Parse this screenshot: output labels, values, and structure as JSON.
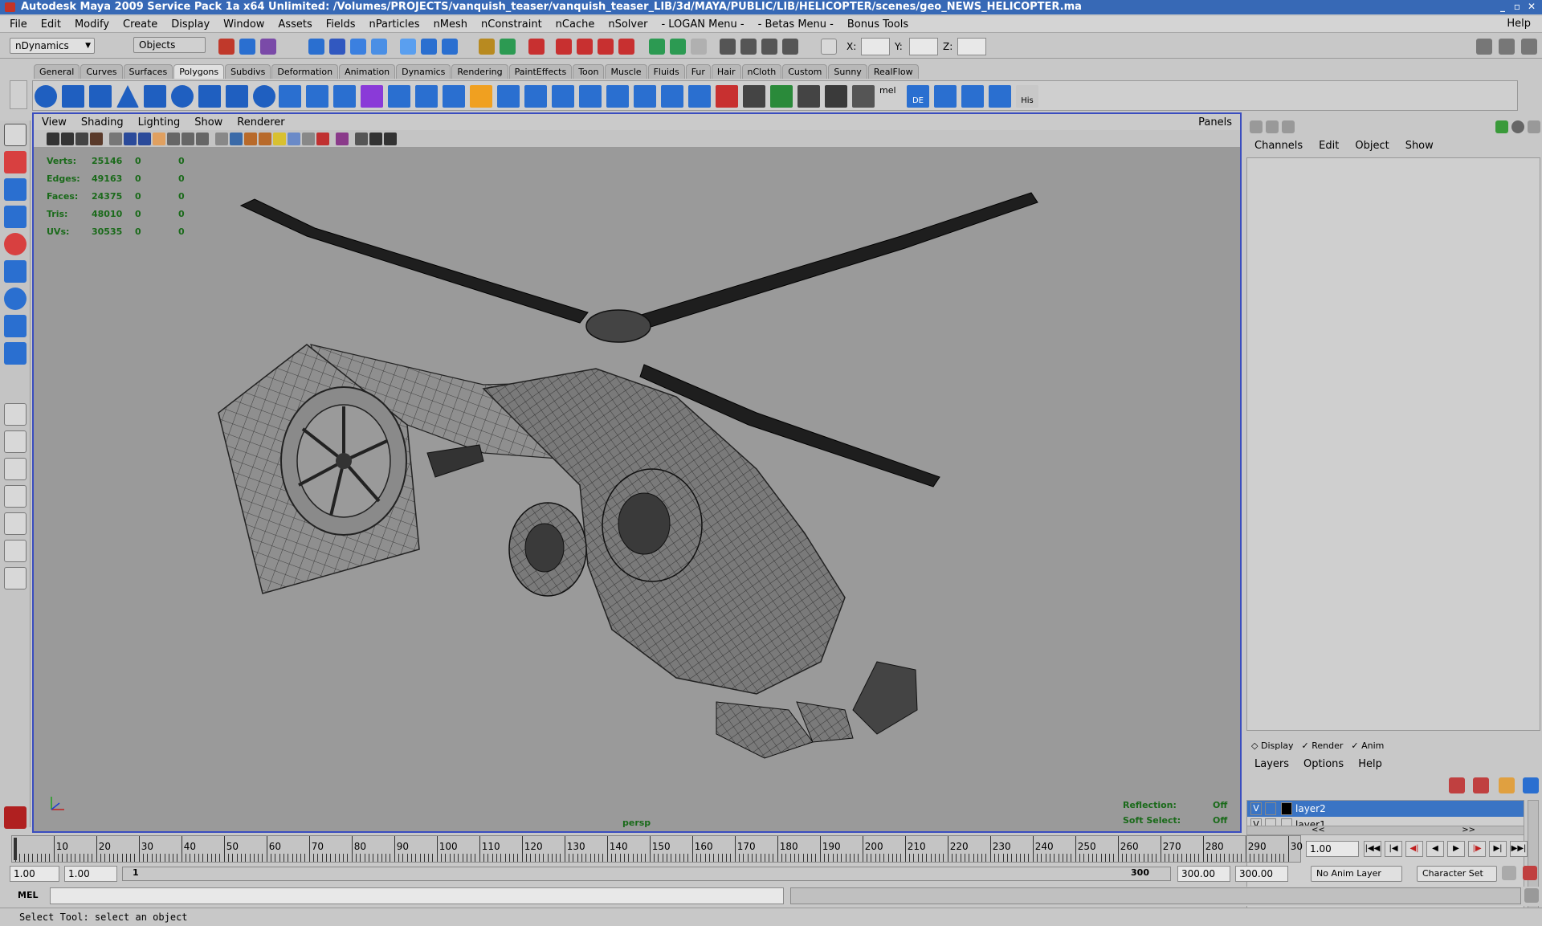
{
  "window": {
    "title": "Autodesk Maya 2009 Service Pack 1a x64 Unlimited: /Volumes/PROJECTS/vanquish_teaser/vanquish_teaser_LIB/3d/MAYA/PUBLIC/LIB/HELICOPTER/scenes/geo_NEWS_HELICOPTER.ma",
    "controls": [
      "_",
      "▫",
      "✕"
    ]
  },
  "menubar": {
    "items": [
      "File",
      "Edit",
      "Modify",
      "Create",
      "Display",
      "Window",
      "Assets",
      "Fields",
      "nParticles",
      "nMesh",
      "nConstraint",
      "nCache",
      "nSolver",
      "- LOGAN Menu -",
      "- Betas Menu -",
      "Bonus Tools"
    ],
    "help": "Help"
  },
  "statusline": {
    "menuset": "nDynamics",
    "selection_mode": "Objects",
    "x_label": "X:",
    "y_label": "Y:",
    "z_label": "Z:",
    "x_value": "",
    "y_value": "",
    "z_value": ""
  },
  "shelf": {
    "tabs": [
      "General",
      "Curves",
      "Surfaces",
      "Polygons",
      "Subdivs",
      "Deformation",
      "Animation",
      "Dynamics",
      "Rendering",
      "PaintEffects",
      "Toon",
      "Muscle",
      "Fluids",
      "Fur",
      "Hair",
      "nCloth",
      "Custom",
      "Sunny",
      "RealFlow"
    ],
    "active_tab": "Polygons",
    "icon_labels": [
      "mel",
      "DE",
      "His"
    ]
  },
  "viewport": {
    "menu": [
      "View",
      "Shading",
      "Lighting",
      "Show",
      "Renderer"
    ],
    "panels_label": "Panels",
    "camera": "persp",
    "hud": [
      {
        "label": "Verts:",
        "v1": "25146",
        "v2": "0",
        "v3": "0"
      },
      {
        "label": "Edges:",
        "v1": "49163",
        "v2": "0",
        "v3": "0"
      },
      {
        "label": "Faces:",
        "v1": "24375",
        "v2": "0",
        "v3": "0"
      },
      {
        "label": "Tris:",
        "v1": "48010",
        "v2": "0",
        "v3": "0"
      },
      {
        "label": "UVs:",
        "v1": "30535",
        "v2": "0",
        "v3": "0"
      }
    ],
    "reflection_label": "Reflection:",
    "reflection_value": "Off",
    "softselect_label": "Soft Select:",
    "softselect_value": "Off"
  },
  "channelbox": {
    "menu": [
      "Channels",
      "Edit",
      "Object",
      "Show"
    ]
  },
  "layers": {
    "tabs": [
      "Display",
      "Render",
      "Anim"
    ],
    "menu": [
      "Layers",
      "Options",
      "Help"
    ],
    "items": [
      {
        "visible": "V",
        "name": "layer2",
        "color": "#000000",
        "selected": true
      },
      {
        "visible": "V",
        "name": "layer1",
        "color": "",
        "selected": false
      }
    ],
    "scroll_left": "<<",
    "scroll_right": ">>"
  },
  "timeline": {
    "labels": [
      "10",
      "20",
      "30",
      "40",
      "50",
      "60",
      "70",
      "80",
      "90",
      "100",
      "110",
      "120",
      "130",
      "140",
      "150",
      "160",
      "170",
      "180",
      "190",
      "200",
      "210",
      "220",
      "230",
      "240",
      "250",
      "260",
      "270",
      "280",
      "290",
      "30"
    ],
    "current_frame": "1.00"
  },
  "rangeslider": {
    "start": "1.00",
    "anim_start": "1.00",
    "range_start_label": "1",
    "range_end_label": "300",
    "range_end": "300.00",
    "anim_end": "300.00",
    "anim_layer": "No Anim Layer",
    "character_set": "Character Set"
  },
  "commandline": {
    "label": "MEL",
    "value": ""
  },
  "helpline": {
    "text": "Select Tool: select an object"
  }
}
